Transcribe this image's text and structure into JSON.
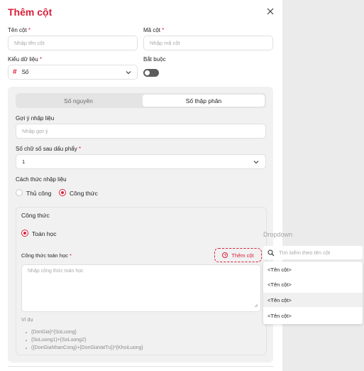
{
  "modal": {
    "title": "Thêm cột",
    "column_name": {
      "label": "Tên cột",
      "required": "*",
      "placeholder": "Nhập tên cột"
    },
    "column_code": {
      "label": "Mã cột",
      "required": "*",
      "placeholder": "Nhập mã cột"
    },
    "data_type": {
      "label": "Kiểu dữ liệu",
      "required": "*",
      "icon": "#",
      "value": "Số"
    },
    "mandatory": {
      "label": "Bắt buộc",
      "on": false
    },
    "number_tabs": [
      "Số nguyên",
      "Số thập phân"
    ],
    "active_tab": "Số thập phân",
    "hint": {
      "label": "Gợi ý nhập liệu",
      "placeholder": "Nhập gợi ý"
    },
    "decimals": {
      "label": "Số chữ số sau dấu phẩy",
      "required": "*",
      "value": "1"
    },
    "input_method": {
      "label": "Cách thức nhập liệu",
      "options": [
        "Thủ công",
        "Công thức"
      ],
      "selected": "Công thức"
    },
    "formula": {
      "section_title": "Công thức",
      "type_option": "Toán học",
      "math_label": "Công thức toán học",
      "required": "*",
      "add_column_label": "Thêm cột",
      "placeholder": "Nhập công thức toán học",
      "example_label": "Ví dụ",
      "examples": [
        "{DonGia}*{SoLuong}",
        "{SoLuong1}+{SoLuong2}",
        "({DonGiaNhanCong}+{DonGiaVatTu})*{KhoiLuong}"
      ]
    }
  },
  "dropdown": {
    "title": "Dropdown",
    "search_placeholder": "Tìm kiếm theo tên cột",
    "items": [
      "<Tên cột>",
      "<Tên cột>",
      "<Tên cột>",
      "<Tên cột>"
    ],
    "highlighted_index": 2
  },
  "colors": {
    "accent": "#d8203a",
    "panel": "#f1f1f1",
    "background": "#ebebeb"
  }
}
